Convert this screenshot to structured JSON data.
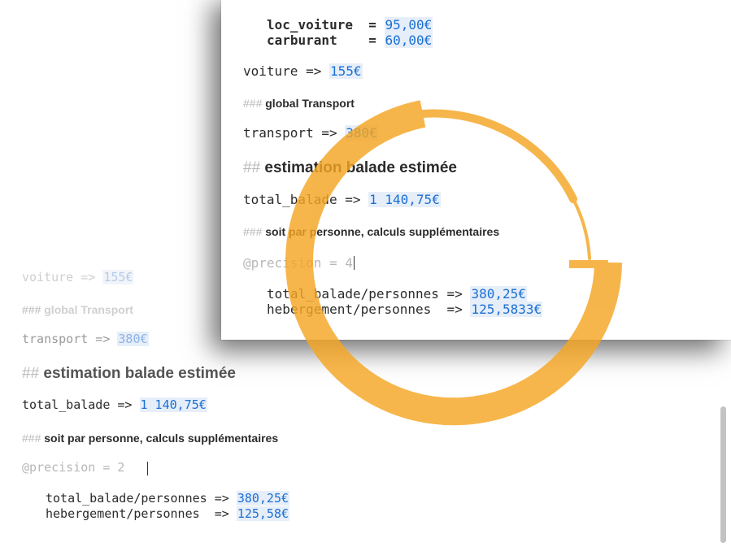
{
  "background_document": {
    "lines": {
      "voiture": {
        "code": "voiture => ",
        "result": "155€"
      },
      "h3_transport": {
        "hash": "###",
        "text": " global Transport"
      },
      "transport": {
        "code": "transport => ",
        "result": "380€"
      },
      "h2_estimation": {
        "hash": "##",
        "text": " estimation balade estimée"
      },
      "total_balade": {
        "code": "total_balade => ",
        "result": "1 140,75€"
      },
      "h3_personne": {
        "hash": "###",
        "text": " soit par personne, calculs supplémentaires"
      },
      "precision": {
        "code": "@precision = 2"
      },
      "per_total": {
        "code": "total_balade/personnes => ",
        "result": "380,25€"
      },
      "per_heberg": {
        "code": "hebergement/personnes  => ",
        "result": "125,58€"
      }
    }
  },
  "zoom_window": {
    "lines": {
      "loc_voiture": {
        "code": "loc_voiture  = ",
        "result": "95,00€"
      },
      "carburant": {
        "code": "carburant    = ",
        "result": "60,00€"
      },
      "voiture": {
        "code": "voiture => ",
        "result": "155€"
      },
      "h3_transport": {
        "hash": "###",
        "text": " global Transport"
      },
      "transport": {
        "code": "transport => ",
        "result": "380€"
      },
      "h2_estimation": {
        "hash": "##",
        "text": " estimation balade estimée"
      },
      "total_balade": {
        "code": "total_balade => ",
        "result": "1 140,75€"
      },
      "h3_personne": {
        "hash": "###",
        "text": " soit par personne, calculs supplémentaires"
      },
      "precision": {
        "code": "@precision = 4"
      },
      "per_total": {
        "code": "total_balade/personnes => ",
        "result": "380,25€"
      },
      "per_heberg": {
        "code": "hebergement/personnes  => ",
        "result": "125,5833€"
      }
    }
  },
  "colors": {
    "result_text": "#1b6fd4",
    "result_bg": "#e6eef9",
    "ring": "#f5a623"
  }
}
